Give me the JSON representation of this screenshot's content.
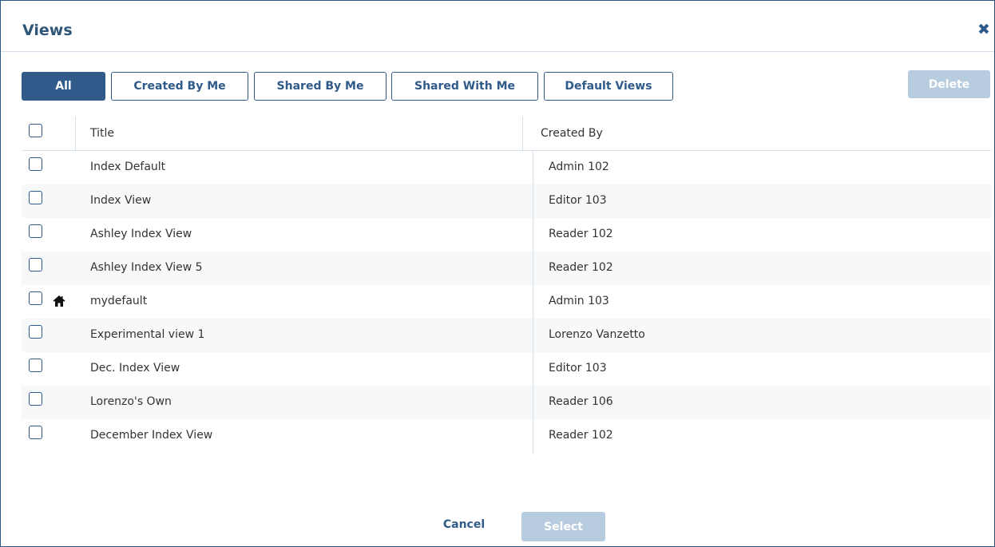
{
  "dialog": {
    "title": "Views",
    "close_icon": "close-icon"
  },
  "filters": [
    {
      "label": "All",
      "active": true
    },
    {
      "label": "Created By Me",
      "active": false
    },
    {
      "label": "Shared By Me",
      "active": false
    },
    {
      "label": "Shared With Me",
      "active": false
    },
    {
      "label": "Default Views",
      "active": false
    }
  ],
  "toolbar": {
    "delete_label": "Delete"
  },
  "table": {
    "columns": [
      "Title",
      "Created By"
    ],
    "rows": [
      {
        "title": "Index Default",
        "created_by": "Admin 102",
        "checked": false,
        "is_default": false
      },
      {
        "title": "Index View",
        "created_by": "Editor 103",
        "checked": false,
        "is_default": false
      },
      {
        "title": "Ashley Index View",
        "created_by": "Reader 102",
        "checked": false,
        "is_default": false
      },
      {
        "title": "Ashley Index View 5",
        "created_by": "Reader 102",
        "checked": false,
        "is_default": false
      },
      {
        "title": "mydefault",
        "created_by": "Admin 103",
        "checked": false,
        "is_default": true,
        "icon": "home-icon"
      },
      {
        "title": "Experimental view 1",
        "created_by": "Lorenzo Vanzetto",
        "checked": false,
        "is_default": false
      },
      {
        "title": "Dec. Index View",
        "created_by": "Editor 103",
        "checked": false,
        "is_default": false
      },
      {
        "title": "Lorenzo's Own",
        "created_by": "Reader 106",
        "checked": false,
        "is_default": false
      },
      {
        "title": "December Index View",
        "created_by": "Reader 102",
        "checked": false,
        "is_default": false
      }
    ]
  },
  "footer": {
    "cancel_label": "Cancel",
    "select_label": "Select"
  },
  "colors": {
    "primary": "#2f5a8a",
    "disabled": "#b8cce0",
    "title": "#2f5577",
    "divider": "#d6e0ea"
  }
}
